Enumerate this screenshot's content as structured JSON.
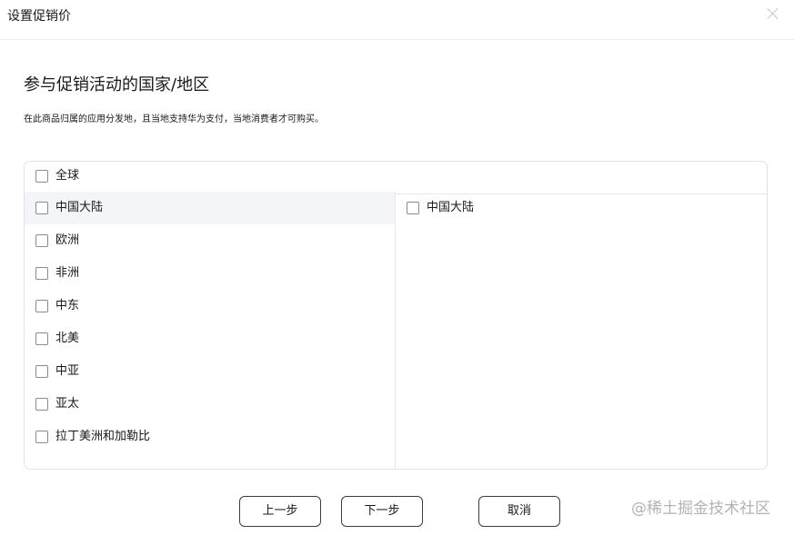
{
  "dialog": {
    "title": "设置促销价"
  },
  "section": {
    "title": "参与促销活动的国家/地区",
    "description": "在此商品归属的应用分发地，且当地支持华为支付，当地消费者才可购买。"
  },
  "panel": {
    "select_all_label": "全球",
    "left_items": [
      {
        "label": "中国大陆",
        "active": true
      },
      {
        "label": "欧洲"
      },
      {
        "label": "非洲"
      },
      {
        "label": "中东"
      },
      {
        "label": "北美"
      },
      {
        "label": "中亚"
      },
      {
        "label": "亚太"
      },
      {
        "label": "拉丁美洲和加勒比"
      }
    ],
    "right_items": [
      {
        "label": "中国大陆"
      }
    ]
  },
  "footer": {
    "prev_label": "上一步",
    "next_label": "下一步",
    "cancel_label": "取消"
  },
  "watermark": "@稀土掘金技术社区",
  "icons": {
    "close": "close-icon"
  },
  "colors": {
    "active_row_bg": "#f4f5f8",
    "border": "#e3e3e3",
    "text": "#191919"
  }
}
